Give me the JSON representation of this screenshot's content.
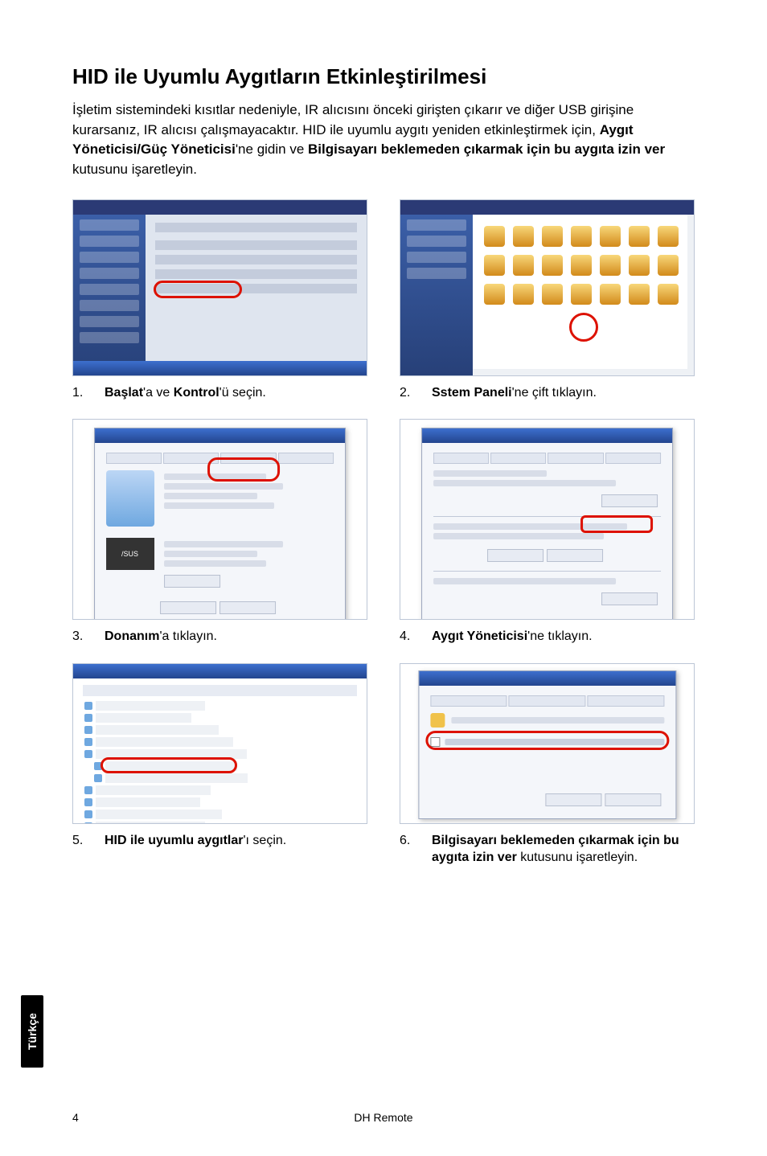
{
  "title": "HID ile Uyumlu Aygıtların Etkinleştirilmesi",
  "intro": {
    "p1": "İşletim sistemindeki kısıtlar nedeniyle, IR alıcısını önceki girişten çıkarır ve diğer USB girişine kurarsanız, IR alıcısı çalışmayacaktır. HID ile uyumlu aygıtı yeniden etkinleştirmek için, ",
    "b1": "Aygıt Yöneticisi/Güç Yöneticisi",
    "p2": "'ne gidin ve ",
    "b2": "Bilgisayarı beklemeden çıkarmak için bu aygıta izin ver",
    "p3": " kutusunu işaretleyin."
  },
  "steps": {
    "s1": {
      "num": "1.",
      "pre": "",
      "b": "Başlat",
      "mid": "'a ve ",
      "b2": "Kontrol",
      "post": "'ü seçin."
    },
    "s2": {
      "num": "2.",
      "pre": "",
      "b": "Sstem Paneli",
      "post": "'ne çift tıklayın."
    },
    "s3": {
      "num": "3.",
      "pre": "",
      "b": "Donanım",
      "post": "'a tıklayın."
    },
    "s4": {
      "num": "4.",
      "pre": "",
      "b": "Aygıt Yöneticisi",
      "post": "'ne tıklayın."
    },
    "s5": {
      "num": "5.",
      "pre": "",
      "b": "HID ile uyumlu aygıtlar",
      "post": "'ı seçin."
    },
    "s6": {
      "num": "6.",
      "pre": "",
      "b": "Bilgisayarı beklemeden çıkarmak için bu aygıta izin ver",
      "post": " kutusunu işaretleyin."
    }
  },
  "lang_tab": "Türkçe",
  "footer": {
    "page": "4",
    "title": "DH Remote"
  }
}
